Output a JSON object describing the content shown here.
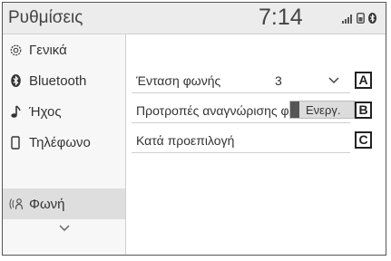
{
  "header": {
    "title": "Ρυθμίσεις",
    "clock": "7:14"
  },
  "sidebar": {
    "items": [
      {
        "label": "Γενικά",
        "icon": "gear-icon"
      },
      {
        "label": "Bluetooth",
        "icon": "bluetooth-icon"
      },
      {
        "label": "Ήχος",
        "icon": "music-note-icon"
      },
      {
        "label": "Τηλέφωνο",
        "icon": "phone-icon"
      },
      {
        "label": "Φωνή",
        "icon": "voice-icon",
        "active": true
      }
    ]
  },
  "settings": {
    "volume": {
      "label": "Ένταση φωνής",
      "value": "3"
    },
    "prompts": {
      "label": "Προτροπές αναγνώρισης φωνής",
      "toggle": "Ενεργ."
    },
    "default": {
      "label": "Κατά προεπιλογή"
    }
  },
  "callouts": [
    "A",
    "B",
    "C"
  ],
  "colors": {
    "header_bg": "#ececec",
    "active_bg": "#dedede",
    "knob": "#555555"
  }
}
